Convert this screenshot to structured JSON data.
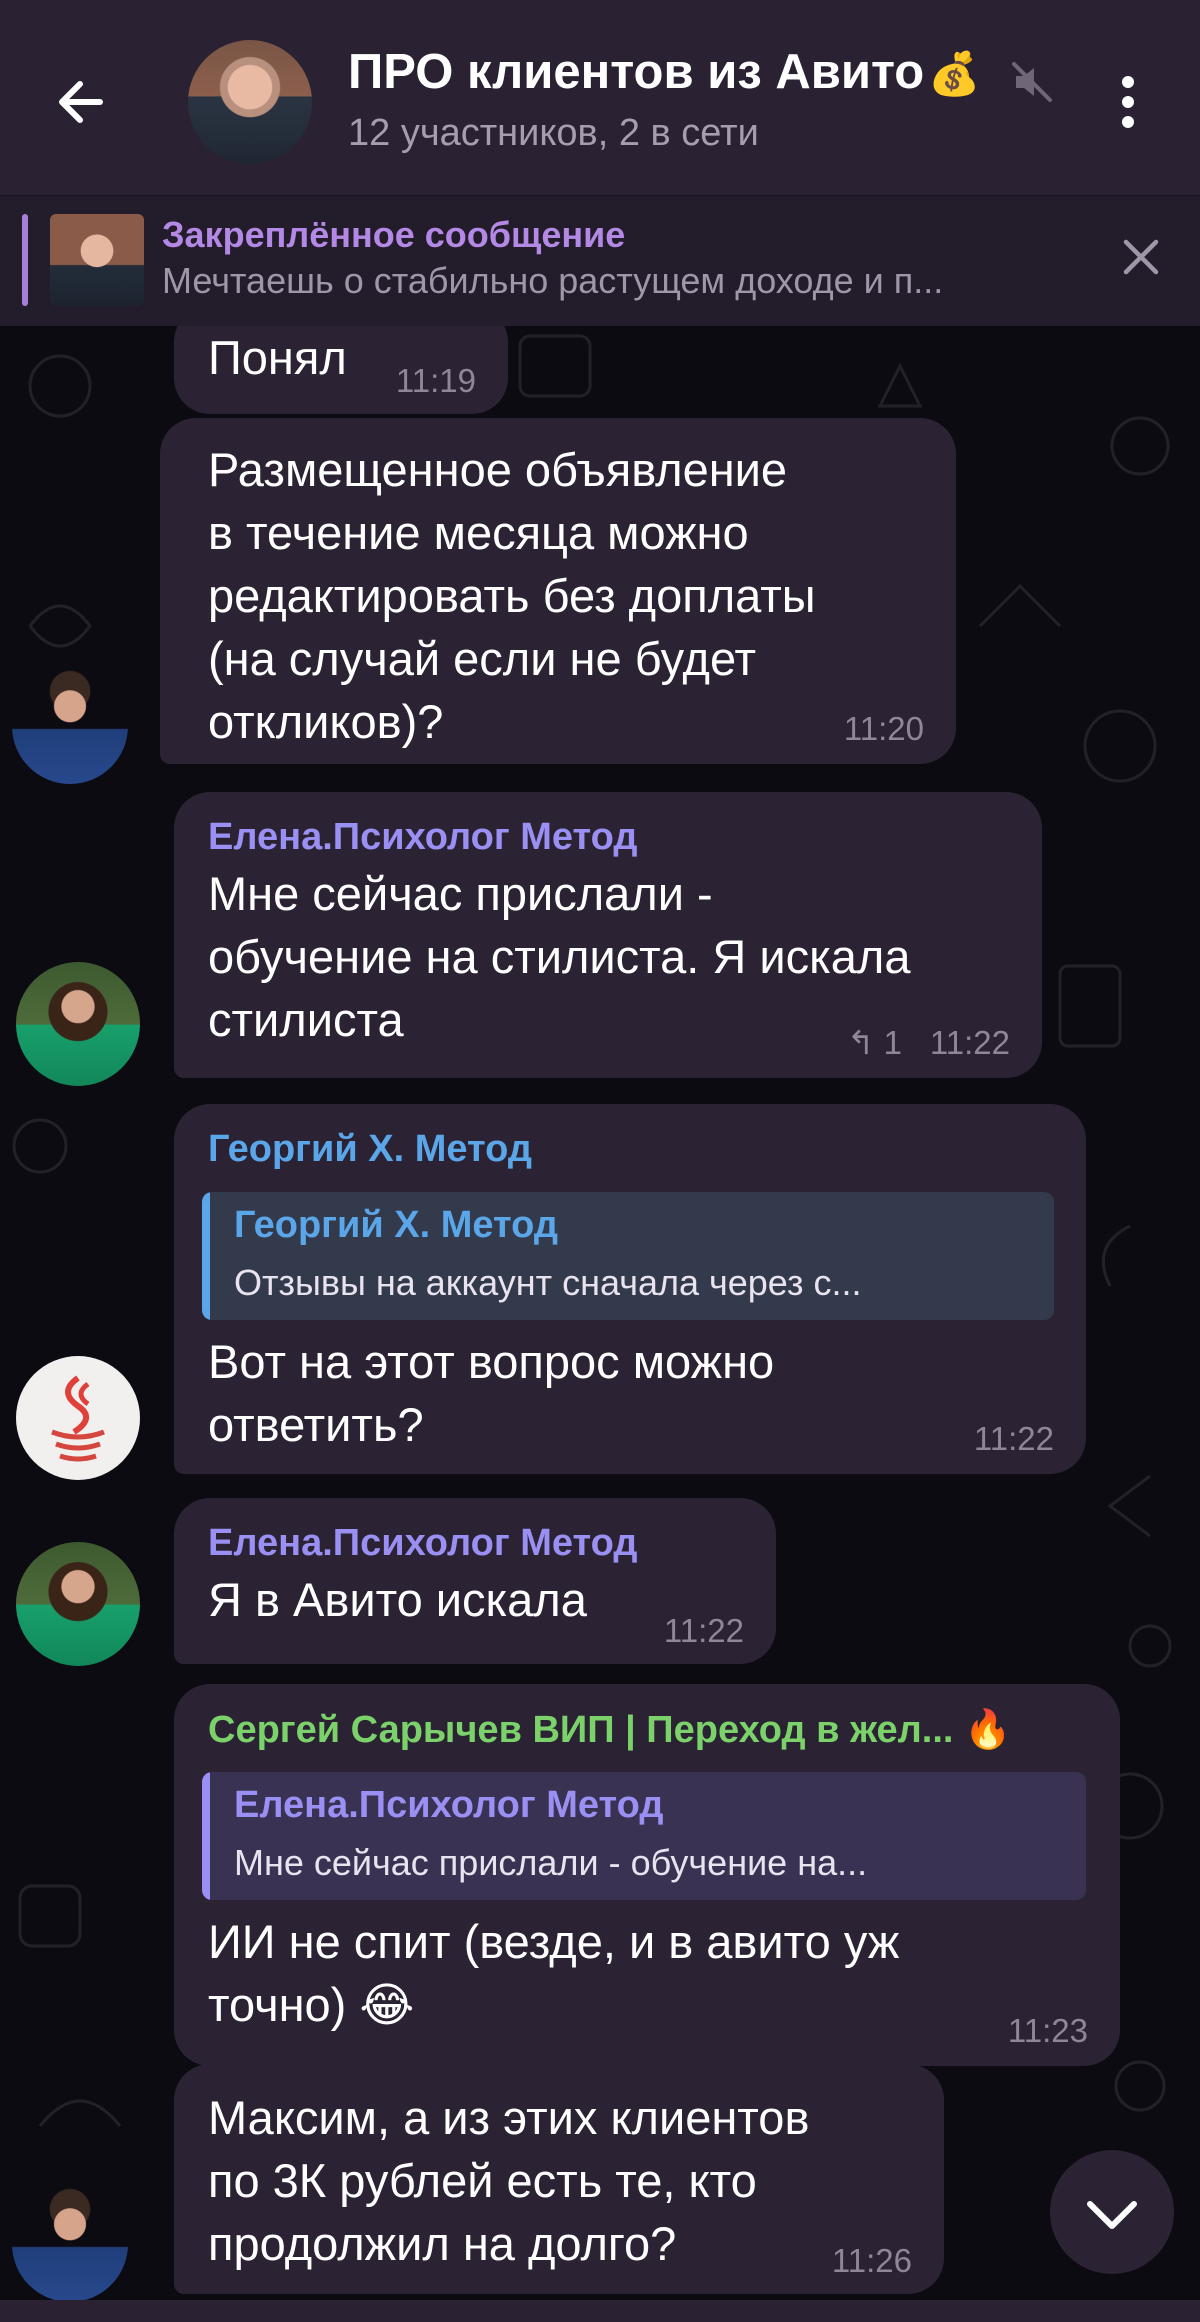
{
  "header": {
    "title": "ПРО клиентов из Авито",
    "title_emoji": "💰",
    "subtitle": "12 участников, 2 в сети",
    "back_icon": "arrow-left-icon",
    "mute_icon": "muted-speaker-icon",
    "more_icon": "vertical-dots-icon"
  },
  "pinned": {
    "title": "Закреплённое сообщение",
    "text": "Мечтаешь о стабильно растущем доходе и п..."
  },
  "messages": [
    {
      "text": "Понял",
      "time": "11:19"
    },
    {
      "text": "Размещенное объявление\nв течение месяца можно\nредактировать без доплаты\n(на случай если не будет\nоткликов)?",
      "time": "11:20"
    },
    {
      "sender": "Елена.Психолог Метод",
      "text": "Мне сейчас прислали -\nобучение на стилиста. Я искала\nстилиста",
      "replies": "1",
      "time": "11:22"
    },
    {
      "sender": "Георгий Х. Метод",
      "reply_name": "Георгий Х. Метод",
      "reply_text": "Отзывы на аккаунт сначала через с...",
      "text": "Вот на этот вопрос можно\nответить?",
      "time": "11:22"
    },
    {
      "sender": "Елена.Психолог Метод",
      "text": "Я в Авито искала",
      "time": "11:22"
    },
    {
      "sender": "Сергей Сарычев ВИП | Переход в жел...",
      "sender_badge": "🔥",
      "reply_name": "Елена.Психолог Метод",
      "reply_text": "Мне сейчас прислали - обучение на...",
      "text": "ИИ не спит (везде, и в авито уж\nточно) 😂",
      "time": "11:23"
    },
    {
      "text": "Максим, а из этих клиентов\nпо 3К рублей есть те, кто\nпродолжил на долго?",
      "time": "11:26"
    }
  ],
  "colors": {
    "header_bg": "#2a2233",
    "bubble_bg": "#2b2333",
    "sender_purple": "#9a8ff2",
    "sender_blue": "#5aa6e8",
    "sender_green": "#7bd26a",
    "pinned_accent": "#b489e6"
  },
  "fab_icon": "chevron-down-icon"
}
